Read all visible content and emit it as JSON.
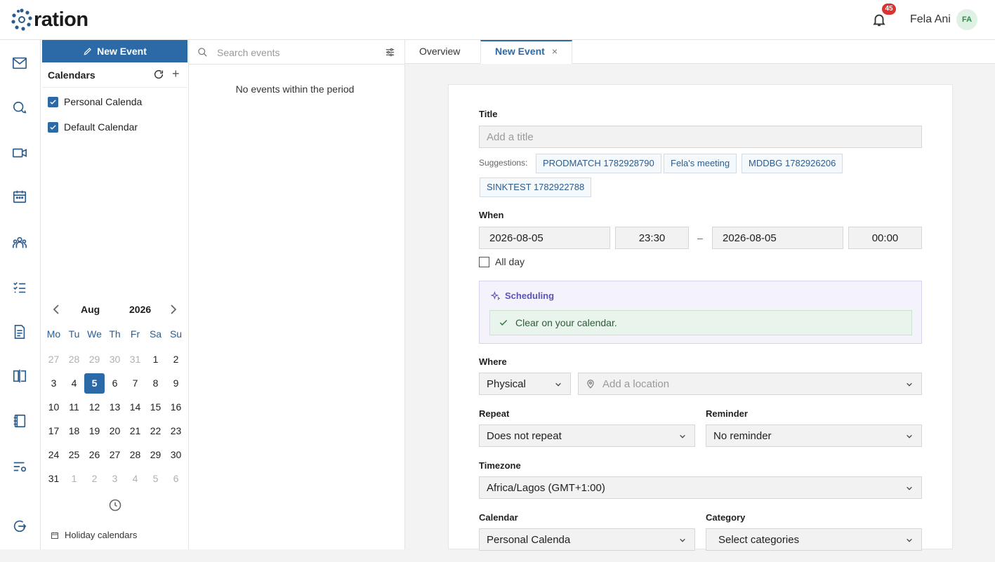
{
  "app": {
    "logo_text": "ration"
  },
  "header": {
    "notification_count": "45",
    "user_name": "Fela Ani",
    "user_initials": "FA"
  },
  "sidebar": {
    "new_event_label": "New Event",
    "calendars_title": "Calendars",
    "calendars": [
      {
        "label": "Personal Calenda",
        "checked": true
      },
      {
        "label": "Default Calendar",
        "checked": true
      }
    ],
    "mini_calendar": {
      "month": "Aug",
      "year": "2026",
      "weekdays": [
        "Mo",
        "Tu",
        "We",
        "Th",
        "Fr",
        "Sa",
        "Su"
      ],
      "selected_day": "5",
      "weeks": [
        [
          "27",
          "28",
          "29",
          "30",
          "31",
          "1",
          "2"
        ],
        [
          "3",
          "4",
          "5",
          "6",
          "7",
          "8",
          "9"
        ],
        [
          "10",
          "11",
          "12",
          "13",
          "14",
          "15",
          "16"
        ],
        [
          "17",
          "18",
          "19",
          "20",
          "21",
          "22",
          "23"
        ],
        [
          "24",
          "25",
          "26",
          "27",
          "28",
          "29",
          "30"
        ],
        [
          "31",
          "1",
          "2",
          "3",
          "4",
          "5",
          "6"
        ]
      ]
    },
    "holiday_label": "Holiday calendars"
  },
  "events": {
    "search_placeholder": "Search events",
    "empty_message": "No events within the period"
  },
  "tabs": [
    {
      "label": "Overview",
      "active": false
    },
    {
      "label": "New Event",
      "active": true,
      "close": "×"
    }
  ],
  "form": {
    "title_label": "Title",
    "title_placeholder": "Add a title",
    "suggestions_label": "Suggestions:",
    "suggestions": [
      "PRODMATCH 1782928790",
      "Fela's meeting",
      "MDDBG 1782926206",
      "SINKTEST 1782922788"
    ],
    "when_label": "When",
    "start_date": "2026-08-05",
    "start_time": "23:30",
    "dash": "–",
    "end_date": "2026-08-05",
    "end_time": "00:00",
    "all_day_label": "All day",
    "scheduling_label": "Scheduling",
    "scheduling_status": "Clear on your calendar.",
    "where_label": "Where",
    "where_type": "Physical",
    "location_placeholder": "Add a location",
    "repeat_label": "Repeat",
    "repeat_value": "Does not repeat",
    "reminder_label": "Reminder",
    "reminder_value": "No reminder",
    "timezone_label": "Timezone",
    "timezone_value": "Africa/Lagos (GMT+1:00)",
    "calendar_label": "Calendar",
    "calendar_value": "Personal Calenda",
    "category_label": "Category",
    "category_value": "Select categories"
  },
  "colors": {
    "accent": "#2b6aa7",
    "badge": "#d93434",
    "scheduling": "#5b54b8",
    "clear_bg": "#e9f4ec"
  }
}
